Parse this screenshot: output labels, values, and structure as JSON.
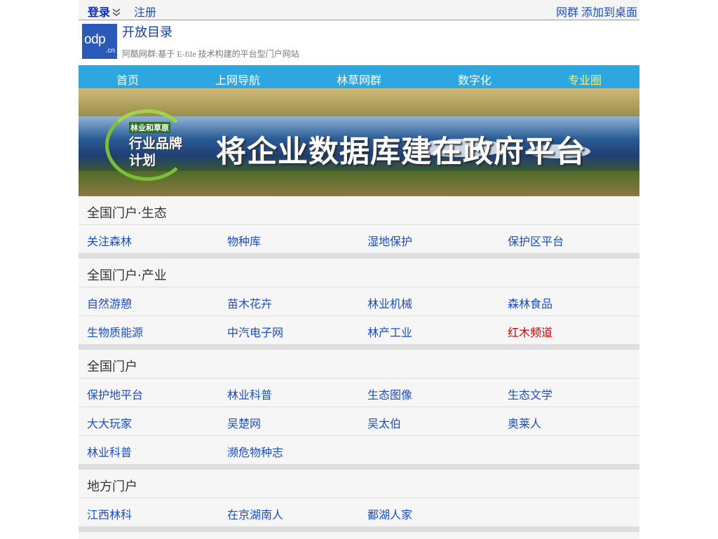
{
  "topbar": {
    "login": "登录",
    "register": "注册",
    "group": "网群",
    "add_desktop": "添加到桌面"
  },
  "header": {
    "logo_text": "odp",
    "logo_cn": ".cn",
    "title": "开放目录",
    "subtitle": "阿酷网群:基于 E-file 技术构建的平台型门户网站"
  },
  "nav": {
    "items": [
      "首页",
      "上网导航",
      "林草网群",
      "数字化",
      "专业圈"
    ],
    "active_index": 4
  },
  "banner": {
    "badge_top": "林业和草原",
    "badge_line1": "行业品牌",
    "badge_line2": "计划",
    "slogan": "将企业数据库建在政府平台"
  },
  "sections": [
    {
      "title": "全国门户·生态",
      "rows": [
        [
          "关注森林",
          "物种库",
          "湿地保护",
          "保护区平台"
        ]
      ]
    },
    {
      "title": "全国门户·产业",
      "rows": [
        [
          "自然游憩",
          "苗木花卉",
          "林业机械",
          "森林食品"
        ],
        [
          "生物质能源",
          "中汽电子网",
          "林产工业",
          "红木频道"
        ]
      ]
    },
    {
      "title": "全国门户",
      "rows": [
        [
          "保护地平台",
          "林业科普",
          "生态图像",
          "生态文学"
        ],
        [
          "大大玩家",
          "吴楚网",
          "吴太伯",
          "奥莱人"
        ],
        [
          "林业科普",
          "濒危物种志"
        ]
      ]
    },
    {
      "title": "地方门户",
      "rows": [
        [
          "江西林科",
          "在京湖南人",
          "鄱湖人家"
        ]
      ]
    }
  ],
  "colors": {
    "link": "#1a4dc4",
    "nav_bg": "#2ea7e0",
    "nav_active": "#f5f36b",
    "highlight_link": "#d20000"
  }
}
